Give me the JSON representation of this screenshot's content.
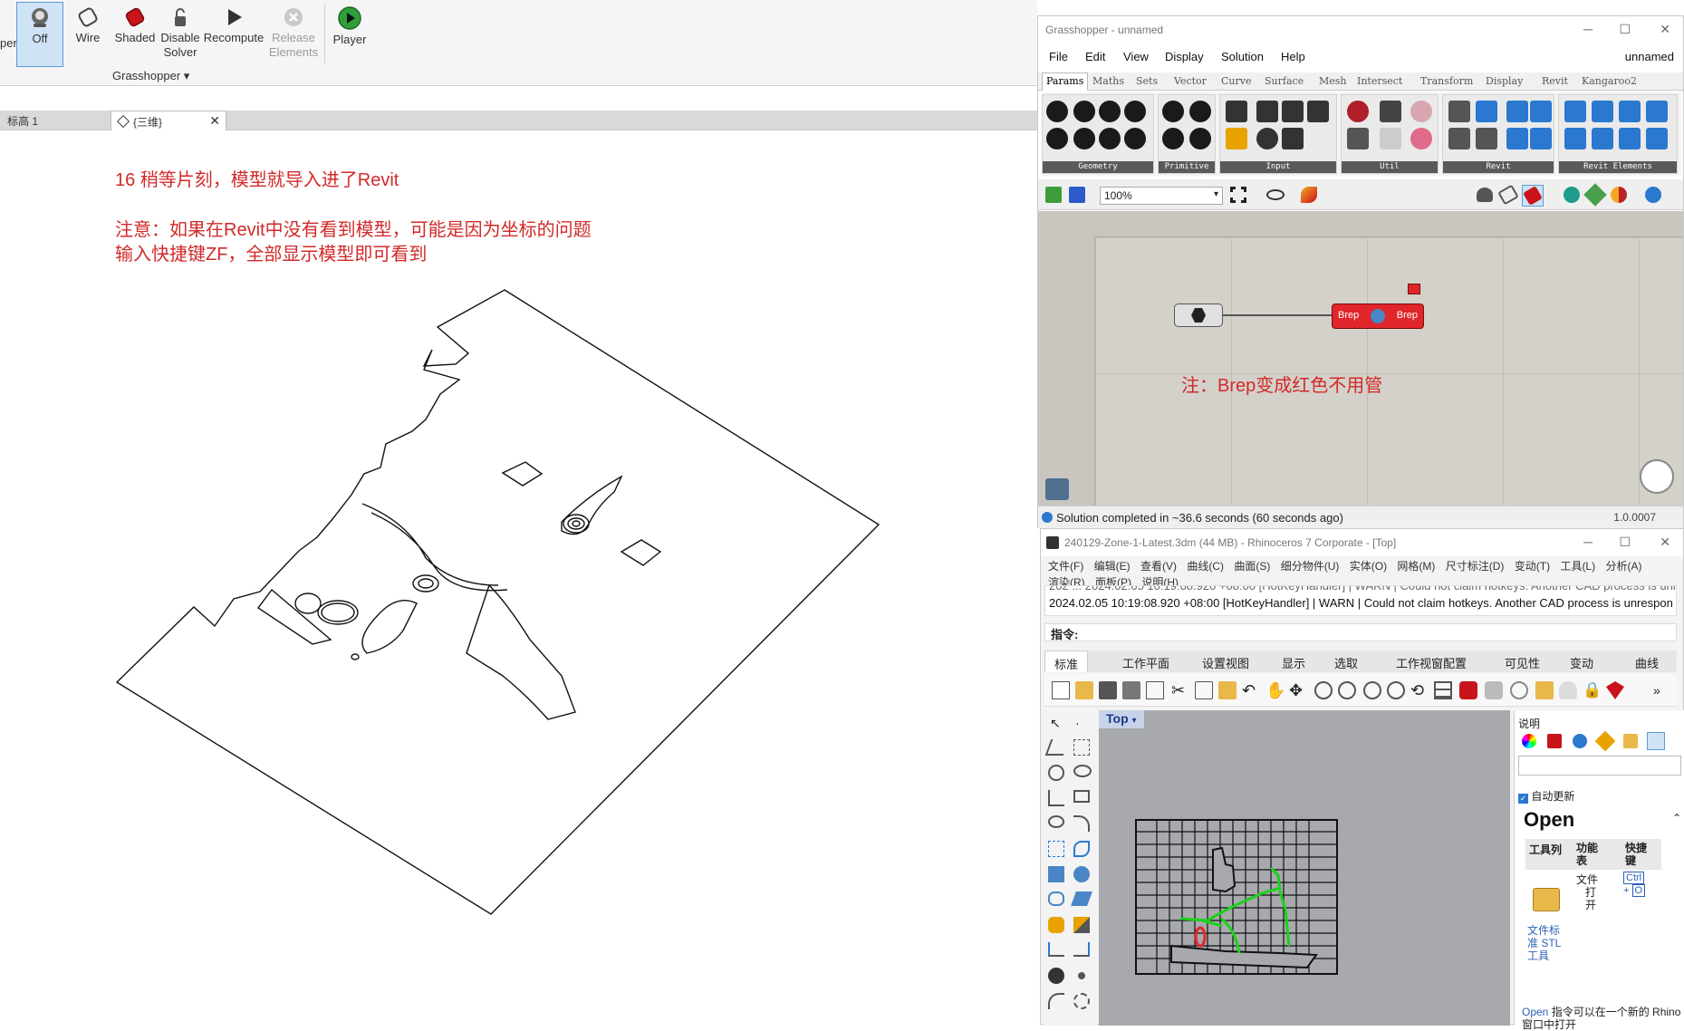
{
  "ribbon": {
    "buttons": [
      {
        "label": "Off",
        "icon": "off-ghost-icon",
        "active": true
      },
      {
        "label": "Wire",
        "icon": "wire-icon"
      },
      {
        "label": "Shaded",
        "icon": "shaded-icon"
      },
      {
        "label": "Disable\nSolver",
        "label1": "Disable",
        "label2": "Solver",
        "icon": "lock-icon"
      },
      {
        "label": "Recompute",
        "icon": "play-icon"
      },
      {
        "label1": "Release",
        "label2": "Elements",
        "icon": "release-icon",
        "disabled": true
      },
      {
        "label": "Player",
        "icon": "player-icon"
      }
    ],
    "cut_label": "per",
    "group_label": "Grasshopper ▾"
  },
  "view_tabs": [
    {
      "label": "标高 1",
      "active": false
    },
    {
      "label": "{三维}",
      "active": true
    }
  ],
  "notes": {
    "line1": "16 稍等片刻，模型就导入进了Revit",
    "line2": "注意：如果在Revit中没有看到模型，可能是因为坐标的问题",
    "line3": "输入快捷键ZF，全部显示模型即可看到",
    "gh_note": "注：Brep变成红色不用管"
  },
  "grasshopper": {
    "title": "Grasshopper - unnamed",
    "menu": [
      "File",
      "Edit",
      "View",
      "Display",
      "Solution",
      "Help"
    ],
    "doc_name": "unnamed",
    "tabs": [
      "Params",
      "Maths",
      "Sets",
      "Vector",
      "Curve",
      "Surface",
      "Mesh",
      "Intersect",
      "Transform",
      "Display",
      "Revit",
      "Kangaroo2"
    ],
    "active_tab": "Params",
    "palette_groups": [
      "Geometry",
      "Primitive",
      "Input",
      "Util",
      "Revit",
      "Revit Elements"
    ],
    "zoom": "100%",
    "node_in": "Brep",
    "node_out": "Brep",
    "status": "Solution completed in ~36.6 seconds (60 seconds ago)",
    "version": "1.0.0007",
    "colors": {
      "error_node": "#e0262a",
      "canvas": "#d4d1ca"
    }
  },
  "rhino": {
    "title": "240129-Zone-1-Latest.3dm (44 MB) - Rhinoceros 7 Corporate - [Top]",
    "menu_row1": [
      "文件(F)",
      "编辑(E)",
      "查看(V)",
      "曲线(C)",
      "曲面(S)",
      "细分物件(U)",
      "实体(O)",
      "网格(M)",
      "尺寸标注(D)",
      "变动(T)",
      "工具(L)",
      "分析(A)"
    ],
    "menu_row2": [
      "渲染(R)",
      "面板(P)",
      "说明(H)"
    ],
    "cmd_history_1": "202 ... 2024.02.05 10:19:08.920 +08:00 [HotKeyHandler] | WARN | Could not claim hotkeys. Another CAD process is unrespon",
    "cmd_history_2": "2024.02.05 10:19:08.920 +08:00 [HotKeyHandler] | WARN | Could not claim hotkeys. Another CAD process is unrespon",
    "prompt": "指令:",
    "tabs": [
      "标准",
      "工作平面",
      "设置视图",
      "显示",
      "选取",
      "工作视窗配置",
      "可见性",
      "变动",
      "曲线"
    ],
    "viewport_label": "Top",
    "panel": {
      "title": "说明",
      "auto_update": "自动更新",
      "command": "Open",
      "col1": "工具列",
      "col2": "功能表",
      "col3": "快捷键",
      "c2_val1": "文件",
      "c2_val2": "打开",
      "c3_val": "Ctrl + O",
      "c3_k1": "Ctrl",
      "c3_k2": "+",
      "c3_k3": "O",
      "tool_link": "文件标准 STL 工具",
      "desc_prefix": "Open",
      "desc": " 指令可以在一个新的 Rhino 窗口中打开"
    }
  }
}
